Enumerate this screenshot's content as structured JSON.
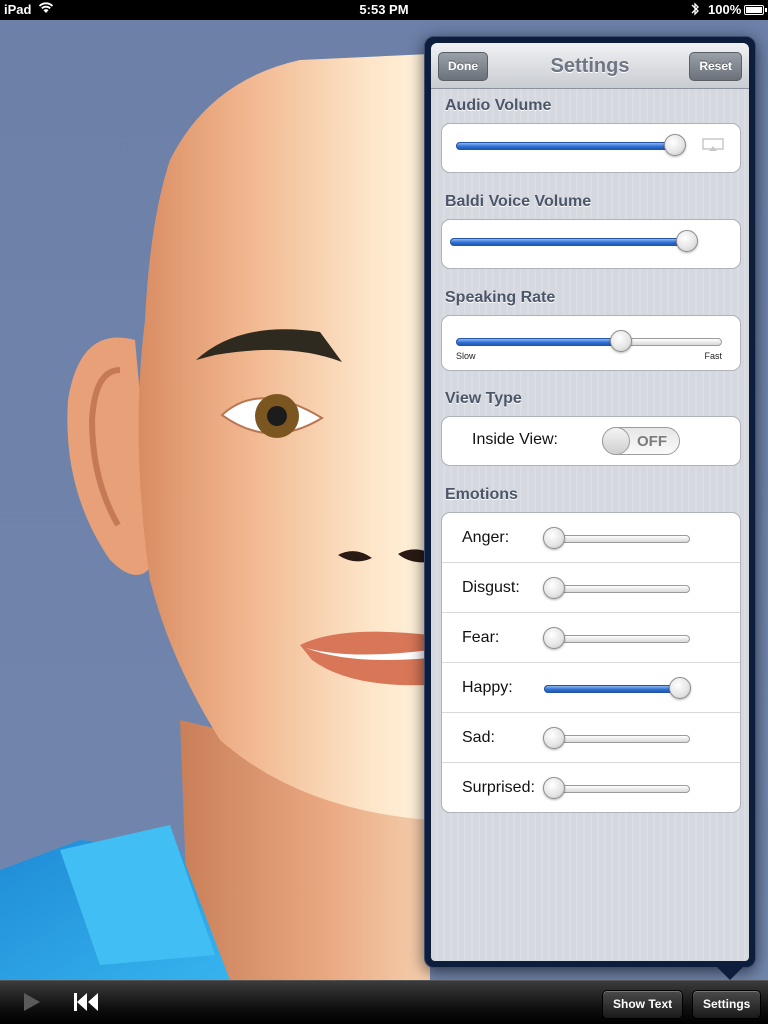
{
  "status_bar": {
    "carrier": "iPad",
    "time": "5:53 PM",
    "battery": "100%",
    "battery_level": 1.0
  },
  "toolbar": {
    "show_text_label": "Show Text",
    "settings_label": "Settings",
    "play_icon": "play-icon",
    "rewind_icon": "rewind-to-start-icon"
  },
  "settings": {
    "title": "Settings",
    "done_label": "Done",
    "reset_label": "Reset",
    "audio_volume": {
      "label": "Audio Volume",
      "value": 0.97,
      "route_icon": "airplay-icon"
    },
    "voice_volume": {
      "label": "Baldi Voice Volume",
      "value": 1.0
    },
    "speaking_rate": {
      "label": "Speaking Rate",
      "value": 0.62,
      "min_label": "Slow",
      "max_label": "Fast"
    },
    "view_type": {
      "label": "View Type",
      "inside_view_label": "Inside View:",
      "inside_view_state": "OFF"
    },
    "emotions": {
      "label": "Emotions",
      "items": [
        {
          "name": "Anger:",
          "value": 0.0
        },
        {
          "name": "Disgust:",
          "value": 0.0
        },
        {
          "name": "Fear:",
          "value": 0.0
        },
        {
          "name": "Happy:",
          "value": 1.0
        },
        {
          "name": "Sad:",
          "value": 0.0
        },
        {
          "name": "Surprised:",
          "value": 0.0
        }
      ]
    }
  },
  "colors": {
    "background": "#6b7ea6",
    "slider_fill": "#2e6ed0",
    "popover_frame": "#0d1d3c",
    "shirt": "#2ea8e6",
    "skin": "#f0b48c"
  }
}
